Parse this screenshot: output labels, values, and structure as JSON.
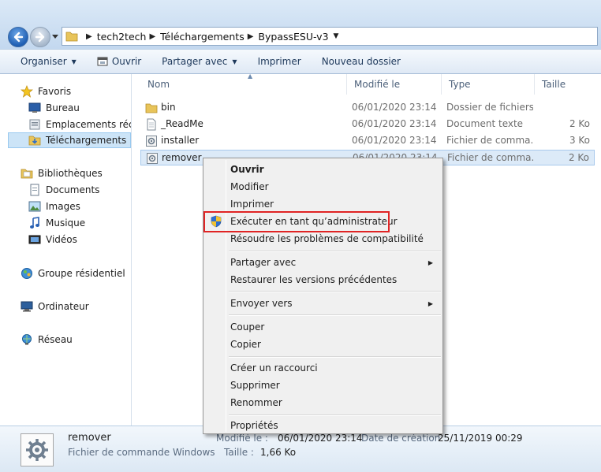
{
  "address": {
    "crumbs": [
      "tech2tech",
      "Téléchargements",
      "BypassESU-v3"
    ]
  },
  "toolbar": {
    "organize": "Organiser",
    "open": "Ouvrir",
    "share": "Partager avec",
    "print": "Imprimer",
    "new_folder": "Nouveau dossier"
  },
  "navpane": {
    "favorites": "Favoris",
    "desktop": "Bureau",
    "recent": "Emplacements récents",
    "downloads": "Téléchargements",
    "libraries": "Bibliothèques",
    "documents": "Documents",
    "images": "Images",
    "music": "Musique",
    "videos": "Vidéos",
    "homegroup": "Groupe résidentiel",
    "computer": "Ordinateur",
    "network": "Réseau"
  },
  "columns": {
    "name": "Nom",
    "modified": "Modifié le",
    "type": "Type",
    "size": "Taille"
  },
  "files": [
    {
      "name": "bin",
      "date": "06/01/2020 23:14",
      "type": "Dossier de fichiers",
      "size": "",
      "icon": "folder-icon"
    },
    {
      "name": "_ReadMe",
      "date": "06/01/2020 23:14",
      "type": "Document texte",
      "size": "2 Ko",
      "icon": "text-file-icon"
    },
    {
      "name": "installer",
      "date": "06/01/2020 23:14",
      "type": "Fichier de comma...",
      "size": "3 Ko",
      "icon": "batch-file-icon"
    },
    {
      "name": "remover",
      "date": "06/01/2020 23:14",
      "type": "Fichier de comma...",
      "size": "2 Ko",
      "icon": "batch-file-icon"
    }
  ],
  "context_menu": {
    "open": "Ouvrir",
    "edit": "Modifier",
    "print": "Imprimer",
    "run_as_admin": "Exécuter en tant qu’administrateur",
    "troubleshoot": "Résoudre les problèmes de compatibilité",
    "share_with": "Partager avec",
    "restore": "Restaurer les versions précédentes",
    "send_to": "Envoyer vers",
    "cut": "Couper",
    "copy": "Copier",
    "create_shortcut": "Créer un raccourci",
    "delete": "Supprimer",
    "rename": "Renommer",
    "properties": "Propriétés"
  },
  "details": {
    "name": "remover",
    "kind": "Fichier de commande Windows",
    "modified_label": "Modifié le :",
    "modified_value": "06/01/2020 23:14",
    "created_label": "Date de création :",
    "created_value": "25/11/2019 00:29",
    "size_label": "Taille :",
    "size_value": "1,66 Ko"
  },
  "colors": {
    "highlight_border": "#e02424",
    "selection": "#dceaf8"
  }
}
